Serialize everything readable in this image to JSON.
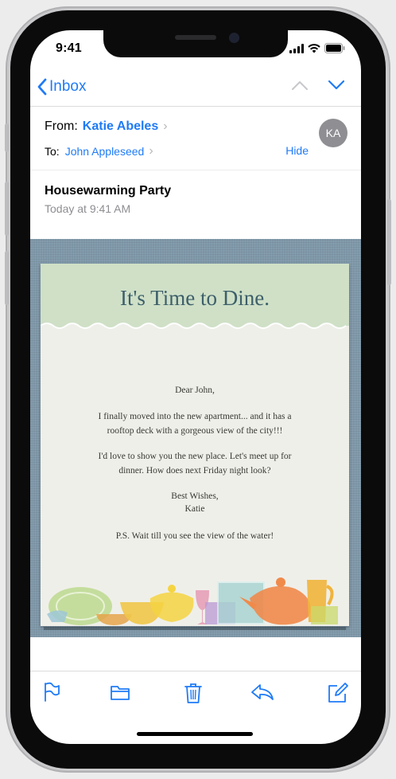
{
  "status": {
    "time": "9:41"
  },
  "nav": {
    "back_label": "Inbox"
  },
  "header": {
    "from_label": "From:",
    "from_name": "Katie Abeles",
    "to_label": "To:",
    "to_name": "John Appleseed",
    "hide_label": "Hide",
    "avatar_initials": "KA"
  },
  "message": {
    "subject": "Housewarming Party",
    "date": "Today at 9:41 AM"
  },
  "card": {
    "title": "It's Time to Dine.",
    "greeting": "Dear John,",
    "line1": "I finally moved into the new apartment... and it has a",
    "line2": "rooftop deck with a gorgeous view of the city!!!",
    "line3": "I'd love to show you the new place. Let's meet up for",
    "line4": "dinner. How does next Friday night look?",
    "closing": "Best Wishes,",
    "signature": "Katie",
    "ps": "P.S. Wait till you see the view of the water!"
  },
  "toolbar": {
    "items": [
      "flag-icon",
      "folder-icon",
      "trash-icon",
      "reply-icon",
      "compose-icon"
    ]
  },
  "colors": {
    "accent": "#1f7bf6"
  }
}
